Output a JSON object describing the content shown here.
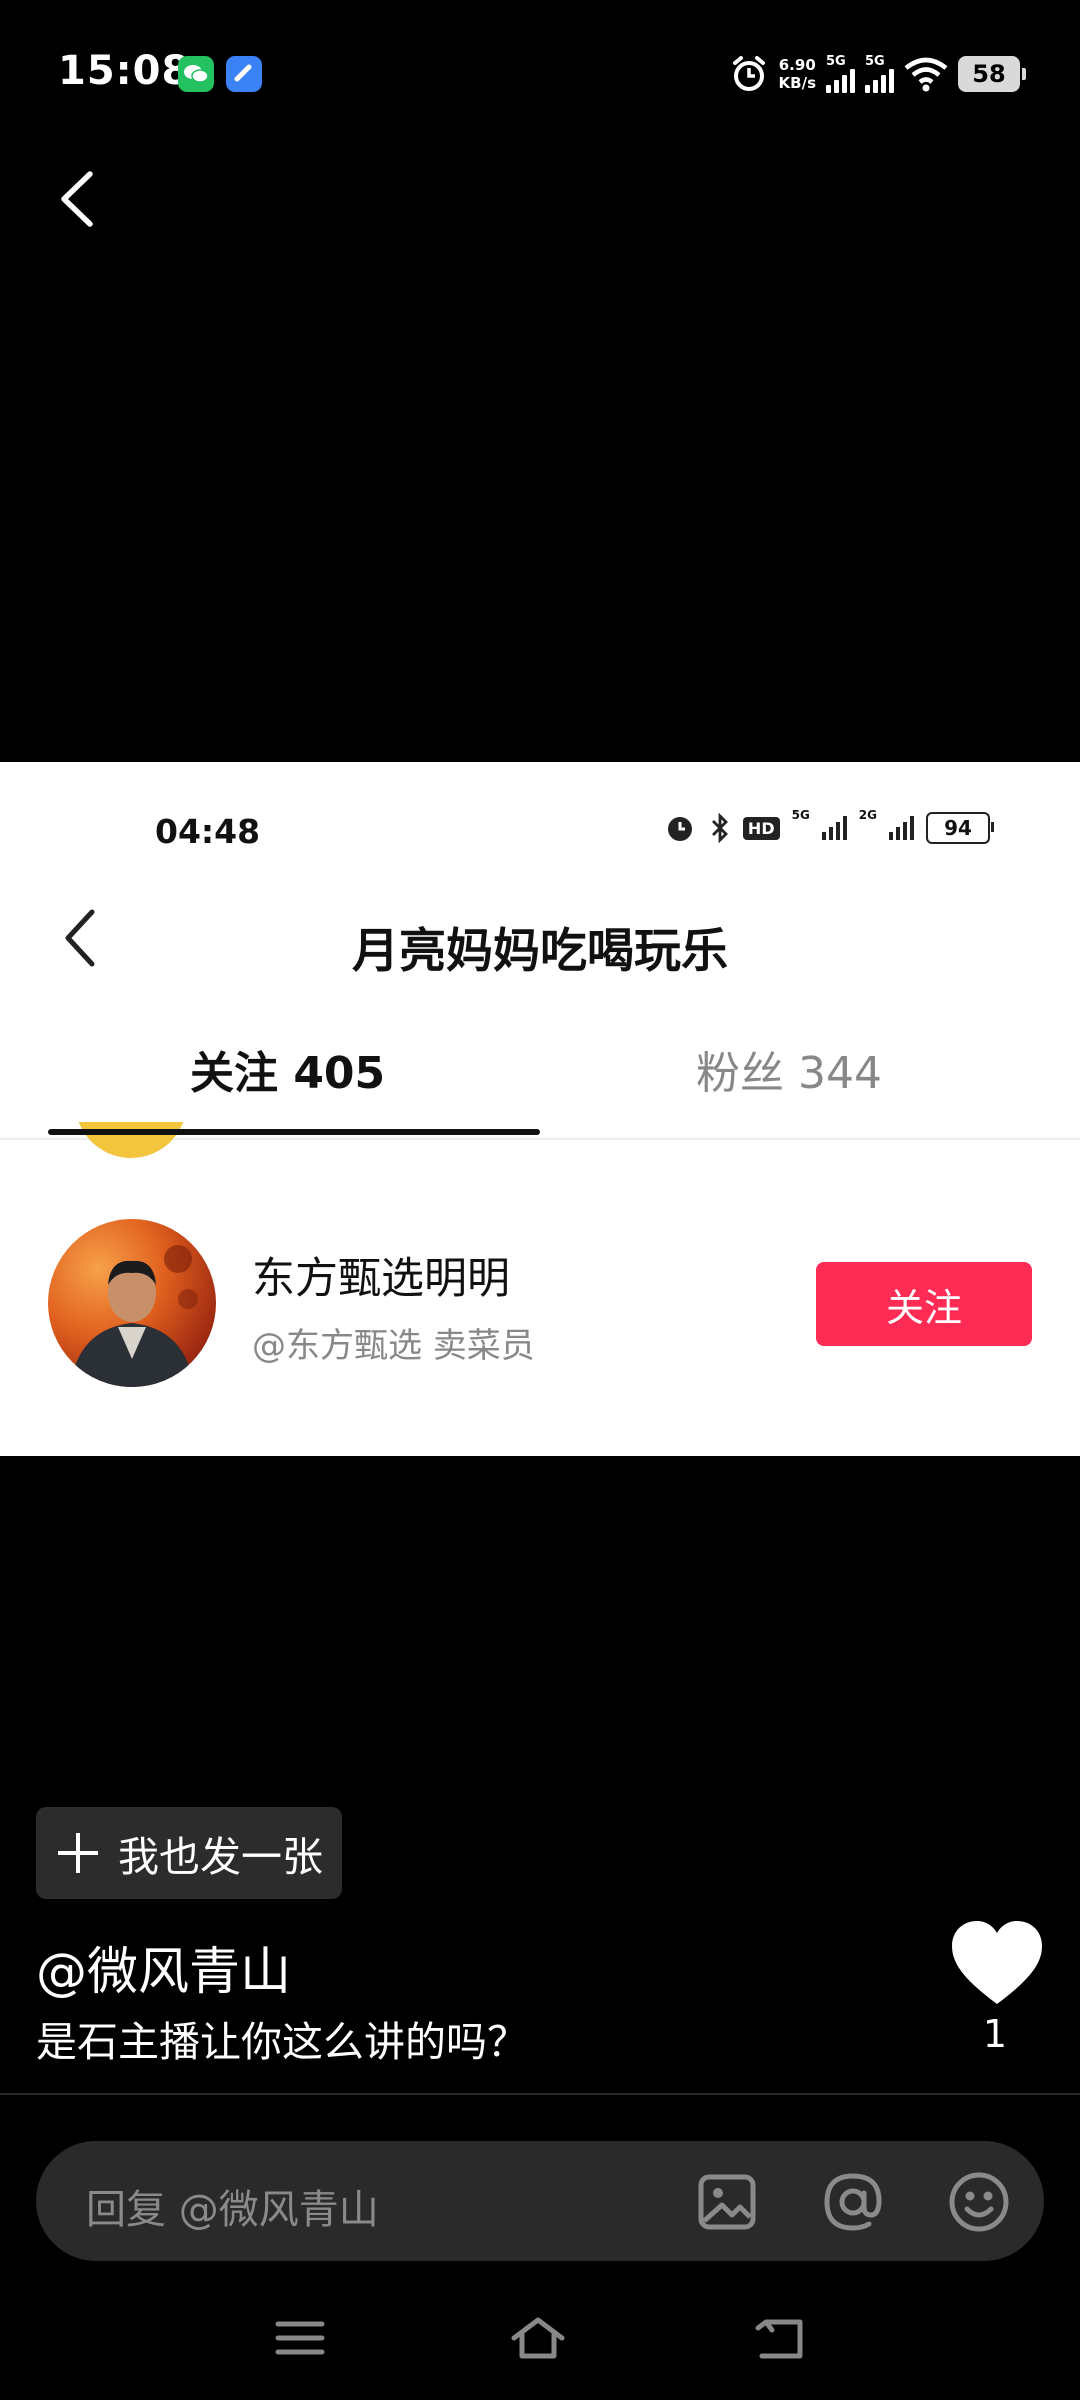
{
  "status_bar": {
    "time": "15:08",
    "net_speed_value": "6.90",
    "net_speed_unit": "KB/s",
    "sim1": "5G",
    "sim2": "5G",
    "battery": "58"
  },
  "screenshot": {
    "status_time": "04:48",
    "status_hd": "HD",
    "status_sim1": "5G",
    "status_sim2": "2G",
    "status_battery": "94",
    "title": "月亮妈妈吃喝玩乐",
    "tab_following": "关注 405",
    "tab_fans": "粉丝 344",
    "user": {
      "name": "东方甄选明明",
      "handle": "@东方甄选 卖菜员",
      "follow_label": "关注"
    }
  },
  "post_button_label": "我也发一张",
  "comment": {
    "username": "@微风青山",
    "text": "是石主播让你这么讲的吗？",
    "like_count": "1"
  },
  "reply": {
    "placeholder": "回复 @微风青山"
  },
  "colors": {
    "accent": "#fe2c55",
    "background": "#000000"
  }
}
